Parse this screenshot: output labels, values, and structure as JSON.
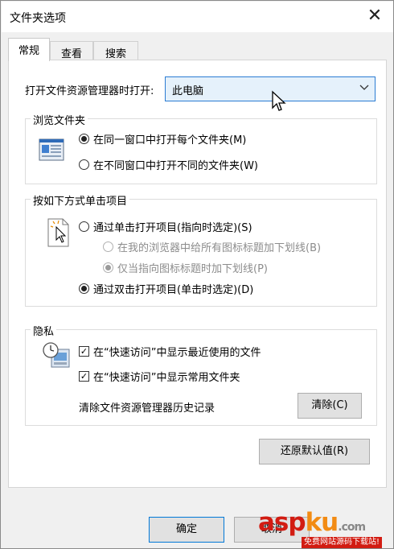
{
  "window": {
    "title": "文件夹选项",
    "close_glyph": "✕"
  },
  "tabs": [
    {
      "label": "常规",
      "active": true
    },
    {
      "label": "查看",
      "active": false
    },
    {
      "label": "搜索",
      "active": false
    }
  ],
  "open_explorer": {
    "label": "打开文件资源管理器时打开:",
    "value": "此电脑"
  },
  "browse_folders": {
    "title": "浏览文件夹",
    "options": [
      {
        "label": "在同一窗口中打开每个文件夹(M)",
        "selected": true
      },
      {
        "label": "在不同窗口中打开不同的文件夹(W)",
        "selected": false
      }
    ]
  },
  "click_items": {
    "title": "按如下方式单击项目",
    "single_click": {
      "label": "通过单击打开项目(指向时选定)(S)",
      "selected": false
    },
    "sub_options": [
      {
        "label": "在我的浏览器中给所有图标标题加下划线(B)",
        "selected": false
      },
      {
        "label": "仅当指向图标标题时加下划线(P)",
        "selected": true
      }
    ],
    "double_click": {
      "label": "通过双击打开项目(单击时选定)(D)",
      "selected": true
    }
  },
  "privacy": {
    "title": "隐私",
    "checkboxes": [
      {
        "label": "在“快速访问”中显示最近使用的文件",
        "checked": true
      },
      {
        "label": "在“快速访问”中显示常用文件夹",
        "checked": true
      }
    ],
    "clear_history_label": "清除文件资源管理器历史记录",
    "clear_button": "清除(C)"
  },
  "restore_defaults_button": "还原默认值(R)",
  "footer": {
    "ok_button": "确定",
    "cancel_button_partial": "取消"
  },
  "watermark": {
    "asp": "asp",
    "ku": "ku",
    "suffix": ".com",
    "tagline": "免费网站源码下载站!"
  },
  "colors": {
    "accent_blue": "#0078d7",
    "dropdown_highlight": "#e5f1fb",
    "watermark_red": "#d21c12",
    "watermark_orange": "#f28b14"
  }
}
